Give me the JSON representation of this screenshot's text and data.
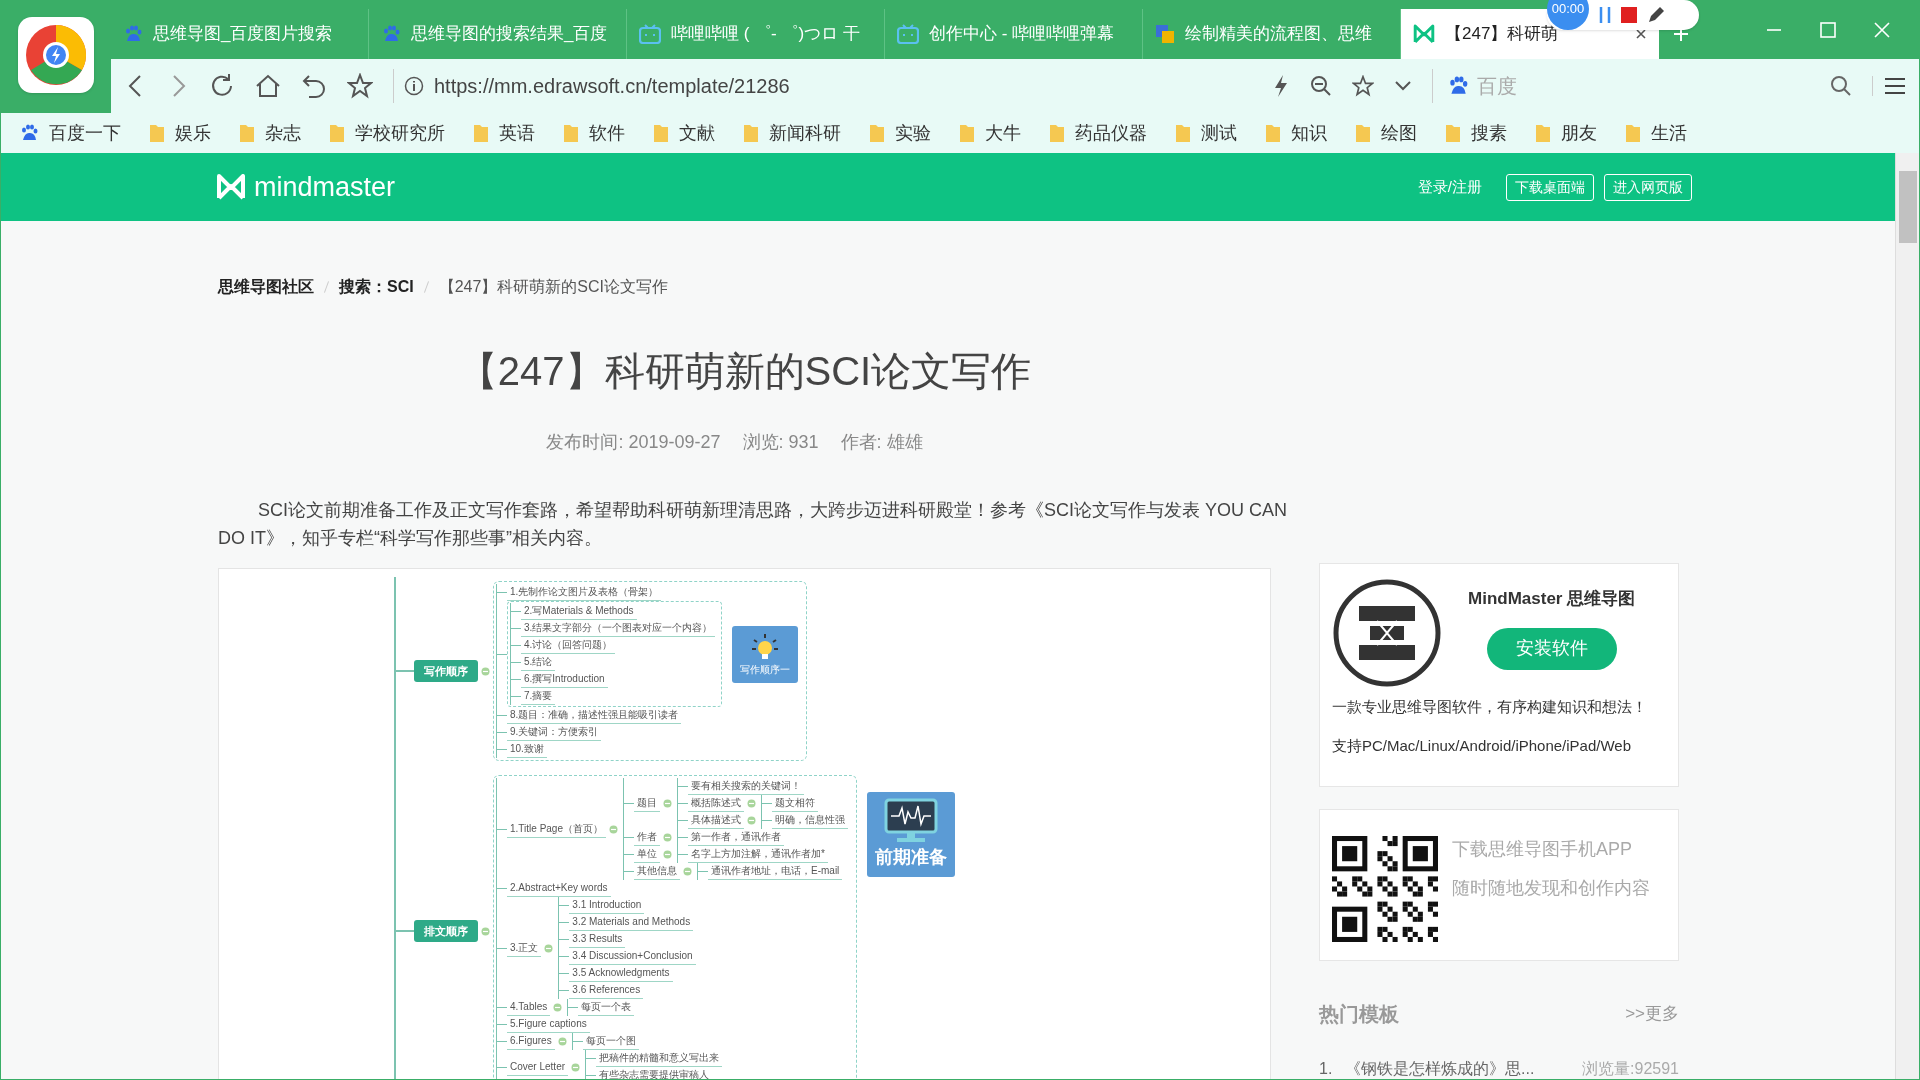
{
  "browser": {
    "tabs": [
      {
        "title": "思维导图_百度图片搜索",
        "kind": "paw",
        "selected": false
      },
      {
        "title": "思维导图的搜索结果_百度",
        "kind": "paw",
        "selected": false
      },
      {
        "title": "哔哩哔哩 ( ゜- ゜)つロ 干",
        "kind": "tv",
        "selected": false
      },
      {
        "title": "创作中心 - 哔哩哔哩弹幕",
        "kind": "tv",
        "selected": false
      },
      {
        "title": "绘制精美的流程图、思维",
        "kind": "edraw",
        "selected": false
      },
      {
        "title": "【247】科研萌",
        "kind": "mm",
        "selected": true
      }
    ],
    "address": "https://mm.edrawsoft.cn/template/21286",
    "search": {
      "placeholder": "百度"
    },
    "bookmarks": [
      {
        "label": "百度一下",
        "kind": "paw"
      },
      {
        "label": "娱乐",
        "kind": "folder"
      },
      {
        "label": "杂志",
        "kind": "folder"
      },
      {
        "label": "学校研究所",
        "kind": "folder"
      },
      {
        "label": "英语",
        "kind": "folder"
      },
      {
        "label": "软件",
        "kind": "folder"
      },
      {
        "label": "文献",
        "kind": "folder"
      },
      {
        "label": "新闻科研",
        "kind": "folder"
      },
      {
        "label": "实验",
        "kind": "folder"
      },
      {
        "label": "大牛",
        "kind": "folder"
      },
      {
        "label": "药品仪器",
        "kind": "folder"
      },
      {
        "label": "测试",
        "kind": "folder"
      },
      {
        "label": "知识",
        "kind": "folder"
      },
      {
        "label": "绘图",
        "kind": "folder"
      },
      {
        "label": "搜素",
        "kind": "folder"
      },
      {
        "label": "朋友",
        "kind": "folder"
      },
      {
        "label": "生活",
        "kind": "folder"
      }
    ]
  },
  "recorder": {
    "time": "00:00"
  },
  "site_header": {
    "logo": "mindmaster",
    "links": [
      {
        "label": "登录/注册",
        "kind": "link"
      },
      {
        "label": "下载桌面端",
        "kind": "outlined"
      },
      {
        "label": "进入网页版",
        "kind": "outlined"
      }
    ]
  },
  "breadcrumb": [
    {
      "label": "思维导图社区",
      "current": false
    },
    {
      "label": "搜索：SCI",
      "current": false
    },
    {
      "label": "【247】科研萌新的SCI论文写作",
      "current": true
    }
  ],
  "article": {
    "title": "【247】科研萌新的SCI论文写作",
    "meta": [
      "发布时间: 2019-09-27",
      "浏览: 931",
      "作者: 雄雄"
    ],
    "intro": "SCI论文前期准备工作及正文写作套路，希望帮助科研萌新理清思路，大跨步迈进科研殿堂！参考《SCI论文写作与发表 YOU CAN DO IT》，知乎专栏“科学写作那些事”相关内容。"
  },
  "mind_map": {
    "callout": {
      "kind": "monitor",
      "label": "前期准备"
    },
    "branches": [
      {
        "label": "写作顺序",
        "children": [
          {
            "label": "1.先制作论文图片及表格（骨架）"
          },
          {
            "kind": "group",
            "callout": {
              "kind": "bulb",
              "label": "写作顺序一"
            },
            "children": [
              {
                "label": "2.写Materials & Methods"
              },
              {
                "label": "3.结果文字部分（一个图表对应一个内容）"
              },
              {
                "label": "4.讨论（回答问题）"
              },
              {
                "label": "5.结论"
              },
              {
                "label": "6.撰写Introduction"
              },
              {
                "label": "7.摘要"
              }
            ]
          },
          {
            "label": "8.题目：准确，描述性强且能吸引读者"
          },
          {
            "label": "9.关键词：方便索引"
          },
          {
            "label": "10.致谢"
          }
        ]
      },
      {
        "label": "排文顺序",
        "children": [
          {
            "label": "1.Title Page（首页）",
            "children": [
              {
                "label": "题目",
                "children": [
                  {
                    "label": "要有相关搜索的关键词！"
                  },
                  {
                    "label": "概括陈述式",
                    "children": [
                      {
                        "label": "题文相符"
                      }
                    ]
                  },
                  {
                    "label": "具体描述式",
                    "children": [
                      {
                        "label": "明确，信息性强"
                      }
                    ]
                  }
                ]
              },
              {
                "label": "作者",
                "children": [
                  {
                    "label": "第一作者，通讯作者"
                  }
                ]
              },
              {
                "label": "单位",
                "children": [
                  {
                    "label": "名字上方加注解，通讯作者加*"
                  }
                ]
              },
              {
                "label": "其他信息",
                "children": [
                  {
                    "label": "通讯作者地址，电话，E-mail"
                  }
                ]
              }
            ]
          },
          {
            "label": "2.Abstract+Key words"
          },
          {
            "label": "3.正文",
            "children": [
              {
                "label": "3.1 Introduction"
              },
              {
                "label": "3.2 Materials and Methods"
              },
              {
                "label": "3.3 Results"
              },
              {
                "label": "3.4 Discussion+Conclusion"
              },
              {
                "label": "3.5 Acknowledgments"
              },
              {
                "label": "3.6 References"
              }
            ]
          },
          {
            "label": "4.Tables",
            "children": [
              {
                "label": "每页一个表"
              }
            ]
          },
          {
            "label": "5.Figure captions"
          },
          {
            "label": "6.Figures",
            "children": [
              {
                "label": "每页一个图"
              }
            ]
          },
          {
            "label": "Cover Letter",
            "children": [
              {
                "label": "把稿件的精髓和意义写出来"
              },
              {
                "label": "有些杂志需要提供审稿人"
              }
            ]
          }
        ]
      }
    ]
  },
  "sidebar": {
    "app_card": {
      "name": "MindMaster 思维导图",
      "button": "安装软件",
      "lines": [
        "一款专业思维导图软件，有序构建知识和想法！",
        "支持PC/Mac/Linux/Android/iPhone/iPad/Web"
      ]
    },
    "mobile_card": {
      "lines": [
        "下载思维导图手机APP",
        "随时随地发现和创作内容"
      ]
    },
    "popular": {
      "title": "热门模板",
      "more": ">>更多",
      "items": [
        {
          "rank": "1.",
          "title": "《钢铁是怎样炼成的》思...",
          "views": "浏览量:92591"
        }
      ]
    }
  }
}
